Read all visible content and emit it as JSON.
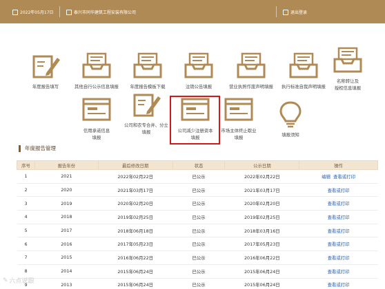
{
  "header": {
    "date": "2022年05月17日",
    "company": "泰兴市同华建筑工程安装有限公司",
    "logout": "退出登录"
  },
  "tiles": [
    {
      "icon": "edit-document-icon",
      "label": "年度报告填写",
      "label2": ""
    },
    {
      "icon": "tray-list-icon",
      "label": "其他自行公示信息填报",
      "label2": ""
    },
    {
      "icon": "tray-list-icon",
      "label": "年度报告模板下载",
      "label2": ""
    },
    {
      "icon": "tray-list-icon",
      "label": "注销公告填报",
      "label2": ""
    },
    {
      "icon": "tray-list-icon",
      "label": "营业执照作废声明填报",
      "label2": ""
    },
    {
      "icon": "tray-list-icon",
      "label": "执行标准自我声明填报",
      "label2": ""
    },
    {
      "icon": "tray-list-icon",
      "label": "名称转让及",
      "label2": "授权信息填报"
    },
    {
      "icon": "browser-form-icon",
      "label": "信用承诺信息",
      "label2": "填报"
    },
    {
      "icon": "edit-document-icon",
      "label": "公司和农专合并、分立",
      "label2": "填报"
    },
    {
      "icon": "browser-form-icon",
      "label": "公司减少注册资本",
      "label2": "填报"
    },
    {
      "icon": "browser-form-icon",
      "label": "市场主体终止歇业",
      "label2": "填报"
    },
    {
      "icon": "lightbulb-icon",
      "label": "填报须知",
      "label2": ""
    }
  ],
  "section": {
    "title": "年度报告管理"
  },
  "table": {
    "headers": [
      "序号",
      "报告年份",
      "最后修改日期",
      "状态",
      "公示日期",
      "操作"
    ],
    "rows": [
      [
        "1",
        "2021",
        "2022年02月22日",
        "已公示",
        "2022年02月22日",
        "编辑",
        "查看或打印"
      ],
      [
        "2",
        "2020",
        "2021年03月17日",
        "已公示",
        "2021年03月17日",
        "",
        "查看或打印"
      ],
      [
        "3",
        "2019",
        "2020年02月20日",
        "已公示",
        "2020年02月20日",
        "",
        "查看或打印"
      ],
      [
        "4",
        "2018",
        "2019年02月25日",
        "已公示",
        "2019年02月25日",
        "",
        "查看或打印"
      ],
      [
        "5",
        "2017",
        "2018年06月18日",
        "已公示",
        "2018年03月16日",
        "",
        "查看或打印"
      ],
      [
        "6",
        "2016",
        "2017年05月23日",
        "已公示",
        "2017年05月23日",
        "",
        "查看或打印"
      ],
      [
        "7",
        "2015",
        "2016年06月22日",
        "已公示",
        "2016年06月22日",
        "",
        "查看或打印"
      ],
      [
        "8",
        "2014",
        "2015年06月24日",
        "已公示",
        "2015年06月24日",
        "",
        "查看或打印"
      ],
      [
        "9",
        "2013",
        "2015年06月24日",
        "已公示",
        "2015年06月24日",
        "",
        "查看或打印"
      ]
    ]
  },
  "watermark": "六点说跟",
  "colors": {
    "brand": "#b08a55",
    "icon": "#b08a55",
    "highlight": "#d01818",
    "link": "#2b63b8"
  }
}
